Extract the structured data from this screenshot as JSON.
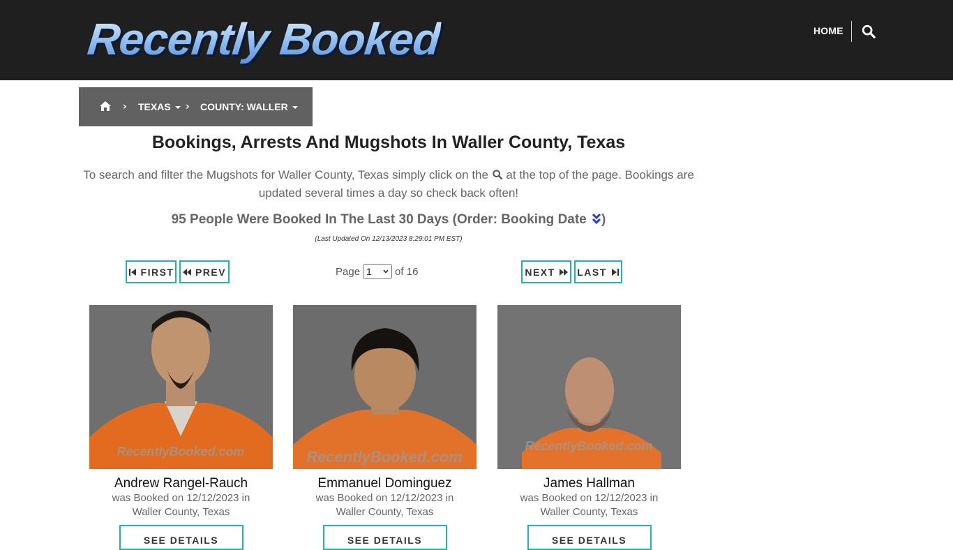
{
  "header": {
    "logo_text": "Recently Booked",
    "nav_home": "HOME",
    "search_icon": "search-icon"
  },
  "breadcrumb": {
    "home_icon": "home-icon",
    "state": "TEXAS",
    "county": "COUNTY: WALLER"
  },
  "page": {
    "title": "Bookings, Arrests And Mugshots In Waller County, Texas",
    "intro_before": "To search and filter the Mugshots for Waller County, Texas simply click on the",
    "intro_after": "at the top of the page. Bookings are updated several times a day so check back often!",
    "count_text": "95 People Were Booked In The Last 30 Days (Order: Booking Date",
    "count_close": ")",
    "last_updated": "(Last Updated On 12/13/2023 8:29:01 PM EST)"
  },
  "pager": {
    "first": "FIRST",
    "prev": "PREV",
    "next": "NEXT",
    "last": "LAST",
    "page_label": "Page",
    "current_page": "1",
    "of_label": "of 16"
  },
  "bookings": [
    {
      "name": "Andrew Rangel-Rauch",
      "line1": "was Booked on 12/12/2023 in",
      "line2": "Waller County, Texas",
      "button": "SEE DETAILS",
      "watermark": "RecentlyBooked.com"
    },
    {
      "name": "Emmanuel Dominguez",
      "line1": "was Booked on 12/12/2023 in",
      "line2": "Waller County, Texas",
      "button": "SEE DETAILS",
      "watermark": "RecentlyBooked.com"
    },
    {
      "name": "James Hallman",
      "line1": "was Booked on 12/12/2023 in",
      "line2": "Waller County, Texas",
      "button": "SEE DETAILS",
      "watermark": "RecentlyBooked.com"
    }
  ],
  "colors": {
    "header_bg": "#1f1f1f",
    "breadcrumb_bg": "#616161",
    "accent_teal": "#1fb5ad",
    "order_icon": "#1f3fd8"
  }
}
